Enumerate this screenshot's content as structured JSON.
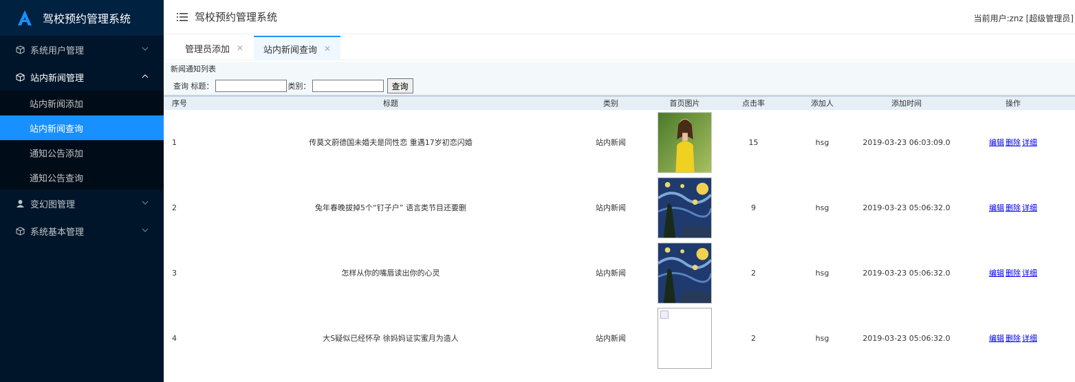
{
  "app": {
    "title": "驾校预约管理系统"
  },
  "sidebar": {
    "menus": [
      {
        "label": "系统用户管理"
      },
      {
        "label": "站内新闻管理"
      },
      {
        "label": "变幻图管理"
      },
      {
        "label": "系统基本管理"
      }
    ],
    "submenu": [
      {
        "label": "站内新闻添加"
      },
      {
        "label": "站内新闻查询"
      },
      {
        "label": "通知公告添加"
      },
      {
        "label": "通知公告查询"
      }
    ]
  },
  "header": {
    "title": "驾校预约管理系统",
    "current_user": "当前用户:znz [超级管理员]"
  },
  "tabs": [
    {
      "label": "管理员添加"
    },
    {
      "label": "站内新闻查询"
    }
  ],
  "list": {
    "title": "新闻通知列表",
    "search": {
      "query_label": "查询 标题：",
      "category_label": "类别：",
      "button": "查询",
      "title_value": "",
      "category_value": ""
    },
    "columns": [
      "序号",
      "标题",
      "类别",
      "首页图片",
      "点击率",
      "添加人",
      "添加时间",
      "操作"
    ],
    "rows": [
      {
        "no": "1",
        "title": "传莫文蔚德国未婚夫是同性恋 重遇17岁初恋闪婚",
        "category": "站内新闻",
        "image": "portrait-photo",
        "clicks": "15",
        "author": "hsg",
        "time": "2019-03-23 06:03:09.0"
      },
      {
        "no": "2",
        "title": "兔年春晚拔掉5个“钉子户” 语言类节目还要删",
        "category": "站内新闻",
        "image": "starry-night-painting",
        "clicks": "9",
        "author": "hsg",
        "time": "2019-03-23 05:06:32.0"
      },
      {
        "no": "3",
        "title": "怎样从你的嘴唇读出你的心灵",
        "category": "站内新闻",
        "image": "starry-night-painting",
        "clicks": "2",
        "author": "hsg",
        "time": "2019-03-23 05:06:32.0"
      },
      {
        "no": "4",
        "title": "大S疑似已经怀孕 徐妈妈证实蜜月为造人",
        "category": "站内新闻",
        "image": "broken-image",
        "clicks": "2",
        "author": "hsg",
        "time": "2019-03-23 05:06:32.0"
      }
    ],
    "ops": {
      "edit": "编辑",
      "delete": "删除",
      "detail": "详细"
    }
  },
  "colors": {
    "sidebar_bg": "#001529",
    "active": "#1890ff"
  }
}
